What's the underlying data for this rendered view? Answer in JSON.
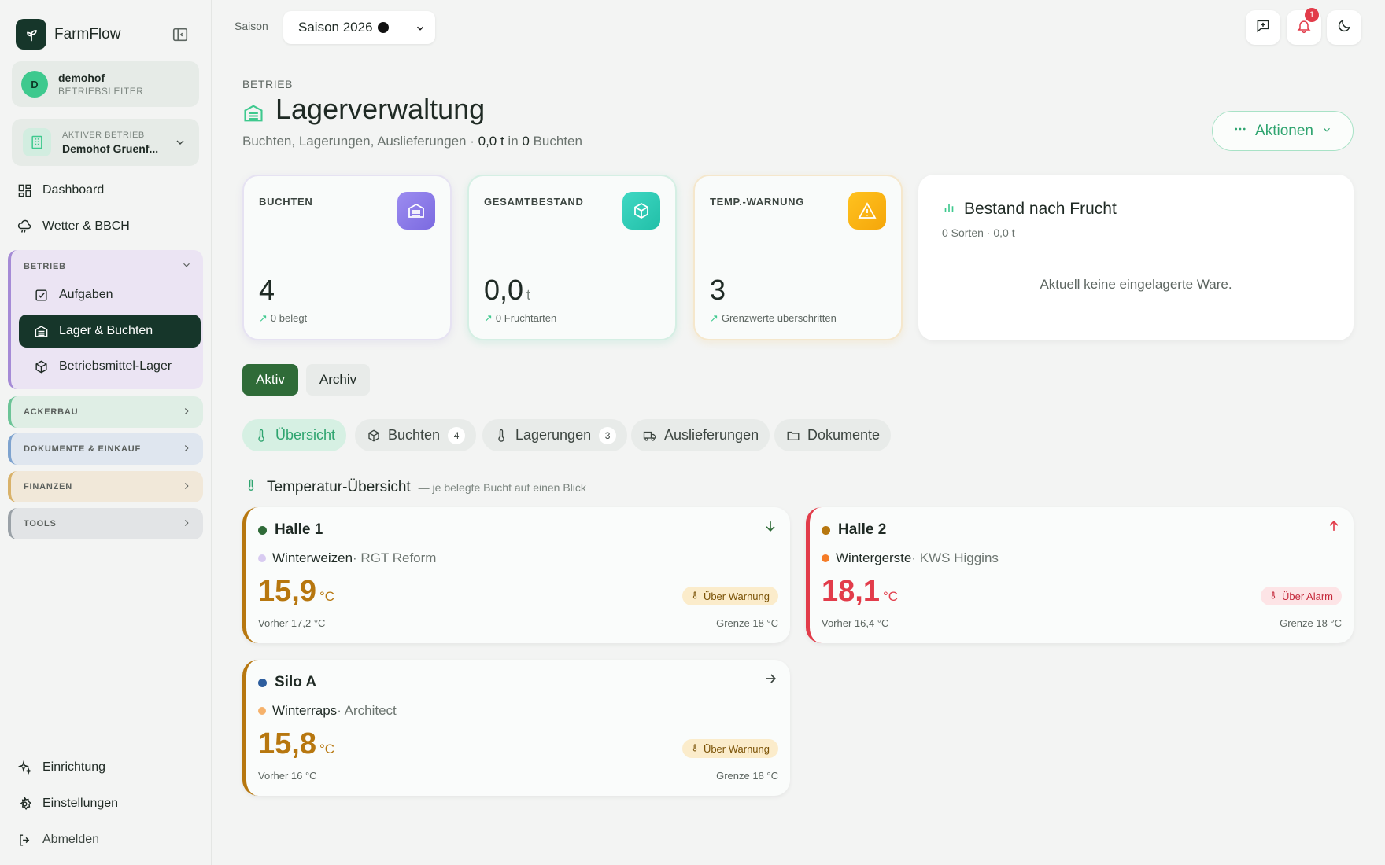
{
  "app": {
    "name": "FarmFlow"
  },
  "user": {
    "initial": "D",
    "name": "demohof",
    "role": "BETRIEBSLEITER"
  },
  "farm": {
    "label": "AKTIVER BETRIEB",
    "name": "Demohof Gruenf..."
  },
  "nav": {
    "dashboard": "Dashboard",
    "weather": "Wetter & BBCH",
    "group_betrieb": "BETRIEB",
    "tasks": "Aufgaben",
    "storage": "Lager & Buchten",
    "supplies": "Betriebsmittel-Lager",
    "group_ackerbau": "ACKERBAU",
    "group_docs": "DOKUMENTE & EINKAUF",
    "group_finance": "FINANZEN",
    "group_tools": "TOOLS",
    "setup": "Einrichtung",
    "settings": "Einstellungen",
    "logout": "Abmelden"
  },
  "topbar": {
    "season_label": "Saison",
    "season_value": "Saison 2026",
    "notification_count": "1"
  },
  "header": {
    "section": "BETRIEB",
    "title": "Lagerverwaltung",
    "subtitle_prefix": "Buchten, Lagerungen, Auslieferungen · ",
    "subtitle_total": "0,0 t",
    "subtitle_in": " in ",
    "subtitle_bays": "0",
    "subtitle_suffix": " Buchten",
    "actions": "Aktionen"
  },
  "stats": [
    {
      "label": "BUCHTEN",
      "value": "4",
      "unit": "",
      "hint": "0 belegt"
    },
    {
      "label": "GESAMTBESTAND",
      "value": "0,0",
      "unit": "t",
      "hint": "0 Fruchtarten"
    },
    {
      "label": "TEMP.-WARNUNG",
      "value": "3",
      "unit": "",
      "hint": "Grenzwerte überschritten"
    }
  ],
  "fruit": {
    "title": "Bestand nach Frucht",
    "meta": "0 Sorten · 0,0 t",
    "empty": "Aktuell keine eingelagerte Ware."
  },
  "toggle": {
    "active": "Aktiv",
    "archive": "Archiv"
  },
  "tabs": [
    {
      "label": "Übersicht",
      "count": ""
    },
    {
      "label": "Buchten",
      "count": "4"
    },
    {
      "label": "Lagerungen",
      "count": "3"
    },
    {
      "label": "Auslieferungen",
      "count": ""
    },
    {
      "label": "Dokumente",
      "count": ""
    }
  ],
  "temp_overview": {
    "title": "Temperatur-Übersicht",
    "hint": "— je belegte Bucht auf einen Blick"
  },
  "bays": [
    {
      "name": "Halle 1",
      "crop": "Winterweizen",
      "variety": " · RGT Reform",
      "temp": "15,9",
      "unit": "°C",
      "badge": "Über Warnung",
      "prev": "Vorher 17,2 °C",
      "limit": "Grenze 18 °C",
      "trend": "down",
      "status": "warning",
      "accent": "#b7770f",
      "dot": "#2f6b38",
      "crop_dot": "#d8cbf1"
    },
    {
      "name": "Halle 2",
      "crop": "Wintergerste",
      "variety": " · KWS Higgins",
      "temp": "18,1",
      "unit": "°C",
      "badge": "Über Alarm",
      "prev": "Vorher 16,4 °C",
      "limit": "Grenze 18 °C",
      "trend": "up",
      "status": "alarm",
      "accent": "#e23c4a",
      "dot": "#b7770f",
      "crop_dot": "#f57c27"
    },
    {
      "name": "Silo A",
      "crop": "Winterraps",
      "variety": " · Architect",
      "temp": "15,8",
      "unit": "°C",
      "badge": "Über Warnung",
      "prev": "Vorher 16 °C",
      "limit": "Grenze 18 °C",
      "trend": "right",
      "status": "warning",
      "accent": "#b7770f",
      "dot": "#2e5e9e",
      "crop_dot": "#f6b26b"
    }
  ],
  "colors": {
    "brand": "#16362a",
    "accent": "#2ea46f",
    "warning": "#b7770f",
    "alarm": "#e23c4a"
  }
}
